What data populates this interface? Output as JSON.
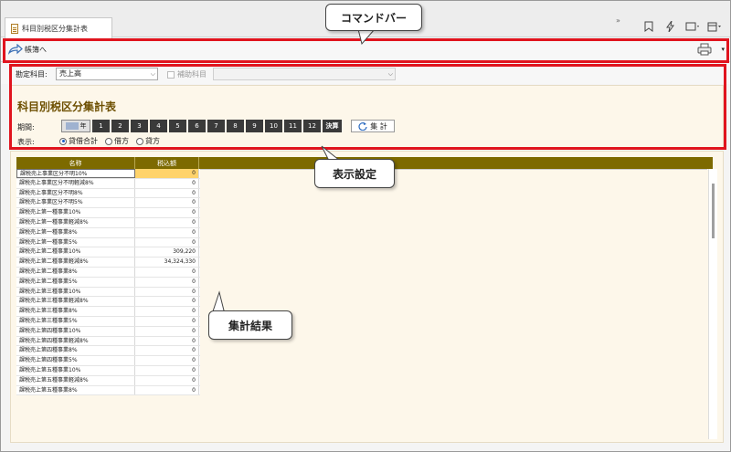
{
  "tab": {
    "title": "科目別税区分集計表"
  },
  "topbar": {
    "overflow": "»"
  },
  "command_bar": {
    "back_label": "帳簿へ"
  },
  "settings": {
    "account_label": "勘定科目:",
    "account_value": "売上高",
    "sub_account_label": "補助科目",
    "sub_account_value": ""
  },
  "report": {
    "title": "科目別税区分集計表",
    "period_label": "期間:",
    "year_label": "年",
    "months": [
      "1",
      "2",
      "3",
      "4",
      "5",
      "6",
      "7",
      "8",
      "9",
      "10",
      "11",
      "12"
    ],
    "settle_label": "決算",
    "aggregate_label": "集 計",
    "display_label": "表示:",
    "display_options": [
      "貸借合計",
      "借方",
      "貸方"
    ],
    "display_selected": "貸借合計"
  },
  "table": {
    "columns": [
      "名称",
      "税込額"
    ],
    "rows": [
      [
        "課税売上事業区分不明10%",
        "0"
      ],
      [
        "課税売上事業区分不明軽減8%",
        "0"
      ],
      [
        "課税売上事業区分不明8%",
        "0"
      ],
      [
        "課税売上事業区分不明5%",
        "0"
      ],
      [
        "課税売上第一種事業10%",
        "0"
      ],
      [
        "課税売上第一種事業軽減8%",
        "0"
      ],
      [
        "課税売上第一種事業8%",
        "0"
      ],
      [
        "課税売上第一種事業5%",
        "0"
      ],
      [
        "課税売上第二種事業10%",
        "309,220"
      ],
      [
        "課税売上第二種事業軽減8%",
        "34,324,330"
      ],
      [
        "課税売上第二種事業8%",
        "0"
      ],
      [
        "課税売上第二種事業5%",
        "0"
      ],
      [
        "課税売上第三種事業10%",
        "0"
      ],
      [
        "課税売上第三種事業軽減8%",
        "0"
      ],
      [
        "課税売上第三種事業8%",
        "0"
      ],
      [
        "課税売上第三種事業5%",
        "0"
      ],
      [
        "課税売上第四種事業10%",
        "0"
      ],
      [
        "課税売上第四種事業軽減8%",
        "0"
      ],
      [
        "課税売上第四種事業8%",
        "0"
      ],
      [
        "課税売上第四種事業5%",
        "0"
      ],
      [
        "課税売上第五種事業10%",
        "0"
      ],
      [
        "課税売上第五種事業軽減8%",
        "0"
      ],
      [
        "課税売上第五種事業8%",
        "0"
      ]
    ]
  },
  "annotations": {
    "command_bar_callout": "コマンドバー",
    "display_settings_callout": "表示設定",
    "results_callout": "集計結果",
    "highlight_color": "#e0141e"
  }
}
